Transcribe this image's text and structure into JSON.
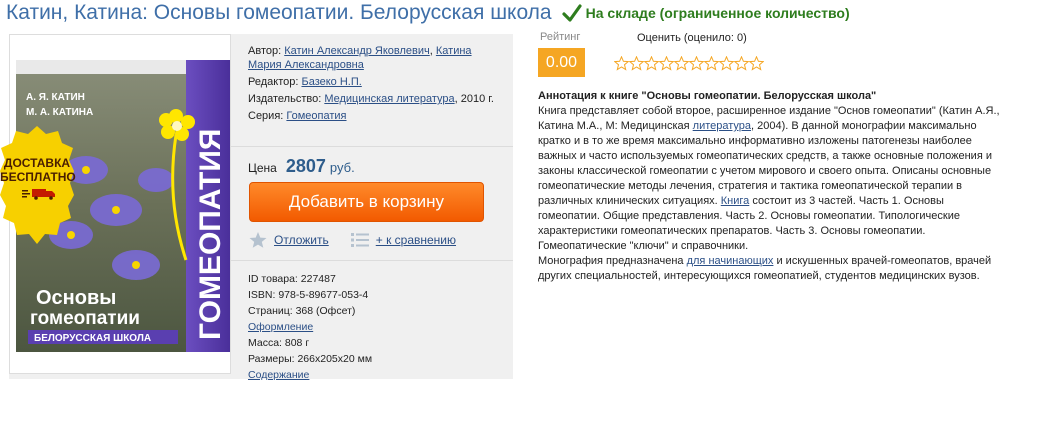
{
  "title": "Катин, Катина: Основы гомеопатии. Белорусская школа",
  "stock": {
    "text": "На складе (ограниченное количество)",
    "icon": "check-icon",
    "color": "#2e7d1e"
  },
  "badge": {
    "line1": "ДОСТАВКА",
    "line2": "БЕСПЛАТНО",
    "icon": "truck-icon"
  },
  "cover": {
    "authors": [
      "А. Я. КАТИН",
      "М. А. КАТИНА"
    ],
    "spine": "ГОМЕОПАТИЯ",
    "title1": "Основы",
    "title2": "гомеопатии",
    "subtitle": "БЕЛОРУССКАЯ ШКОЛА"
  },
  "details": {
    "author_label": "Автор:",
    "author1": "Катин Александр Яковлевич",
    "author_sep": ",",
    "author2": "Катина Мария Александровна",
    "editor_label": "Редактор:",
    "editor": "Базеко Н.П.",
    "publisher_label": "Издательство:",
    "publisher": "Медицинская литература",
    "publisher_year": ", 2010 г.",
    "series_label": "Серия:",
    "series": "Гомеопатия"
  },
  "price": {
    "label": "Цена",
    "value": "2807",
    "currency": "руб."
  },
  "cart_button": "Добавить в корзину",
  "actions": {
    "defer": "Отложить",
    "compare": "+ к сравнению"
  },
  "info": {
    "id": "ID товара: 227487",
    "isbn": "ISBN: 978-5-89677-053-4",
    "pages": "Страниц: 368 (Офсет)",
    "design": "Оформление",
    "weight": "Масса: 808 г",
    "size": "Размеры: 266x205x20 мм",
    "contents": "Содержание"
  },
  "rating": {
    "label": "Рейтинг",
    "value": "0.00",
    "rate_label": "Оценить (оценило: 0)",
    "stars": 10,
    "color": "#f5a623"
  },
  "annotation": {
    "title": "Аннотация к книге \"Основы гомеопатии. Белорусская школа\"",
    "p1a": "Книга представляет собой второе, расширенное издание \"Основ гомеопатии\" (Катин А.Я., Катина М.А., М: Медицинская ",
    "p1link": "литература",
    "p1b": ", 2004). В данной монографии максимально кратко и в то же время максимально информативно изложены патогенезы наиболее важных и часто используемых гомеопатических средств, а также основные положения и законы классической гомеопатии с учетом мирового и своего опыта. Описаны основные гомеопатические методы лечения, стратегия и тактика гомеопатической терапии в различных клинических ситуациях. ",
    "p1link2": "Книга",
    "p1c": " состоит из 3 частей. Часть 1. Основы гомеопатии. Общие представления. Часть 2. Основы гомеопатии. Типологические характеристики гомеопатических препаратов. Часть 3. Основы гомеопатии. Гомеопатические \"ключи\" и справочники.",
    "p2a": "Монография предназначена ",
    "p2link": "для начинающих",
    "p2b": " и искушенных врачей-гомеопатов, врачей других специальностей, интересующихся гомеопатией, студентов медицинских вузов."
  }
}
